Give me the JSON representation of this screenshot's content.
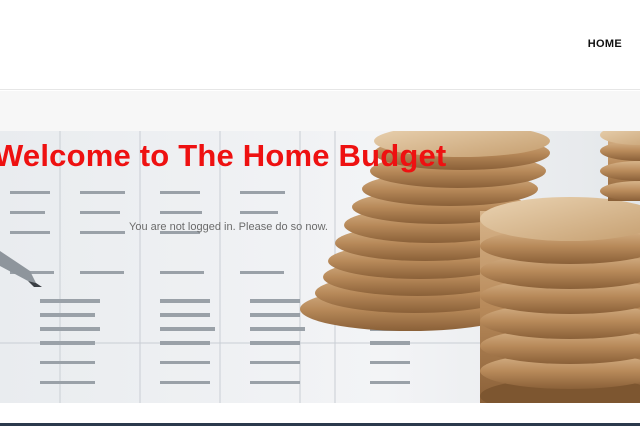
{
  "nav": {
    "home_label": "HOME"
  },
  "hero": {
    "title": "Welcome to The Home Budget",
    "subtitle": "You are not logged in. Please do so now."
  },
  "colors": {
    "title": "#ee1111",
    "text": "#6b6b6b",
    "footer_line": "#2b3a4d"
  }
}
